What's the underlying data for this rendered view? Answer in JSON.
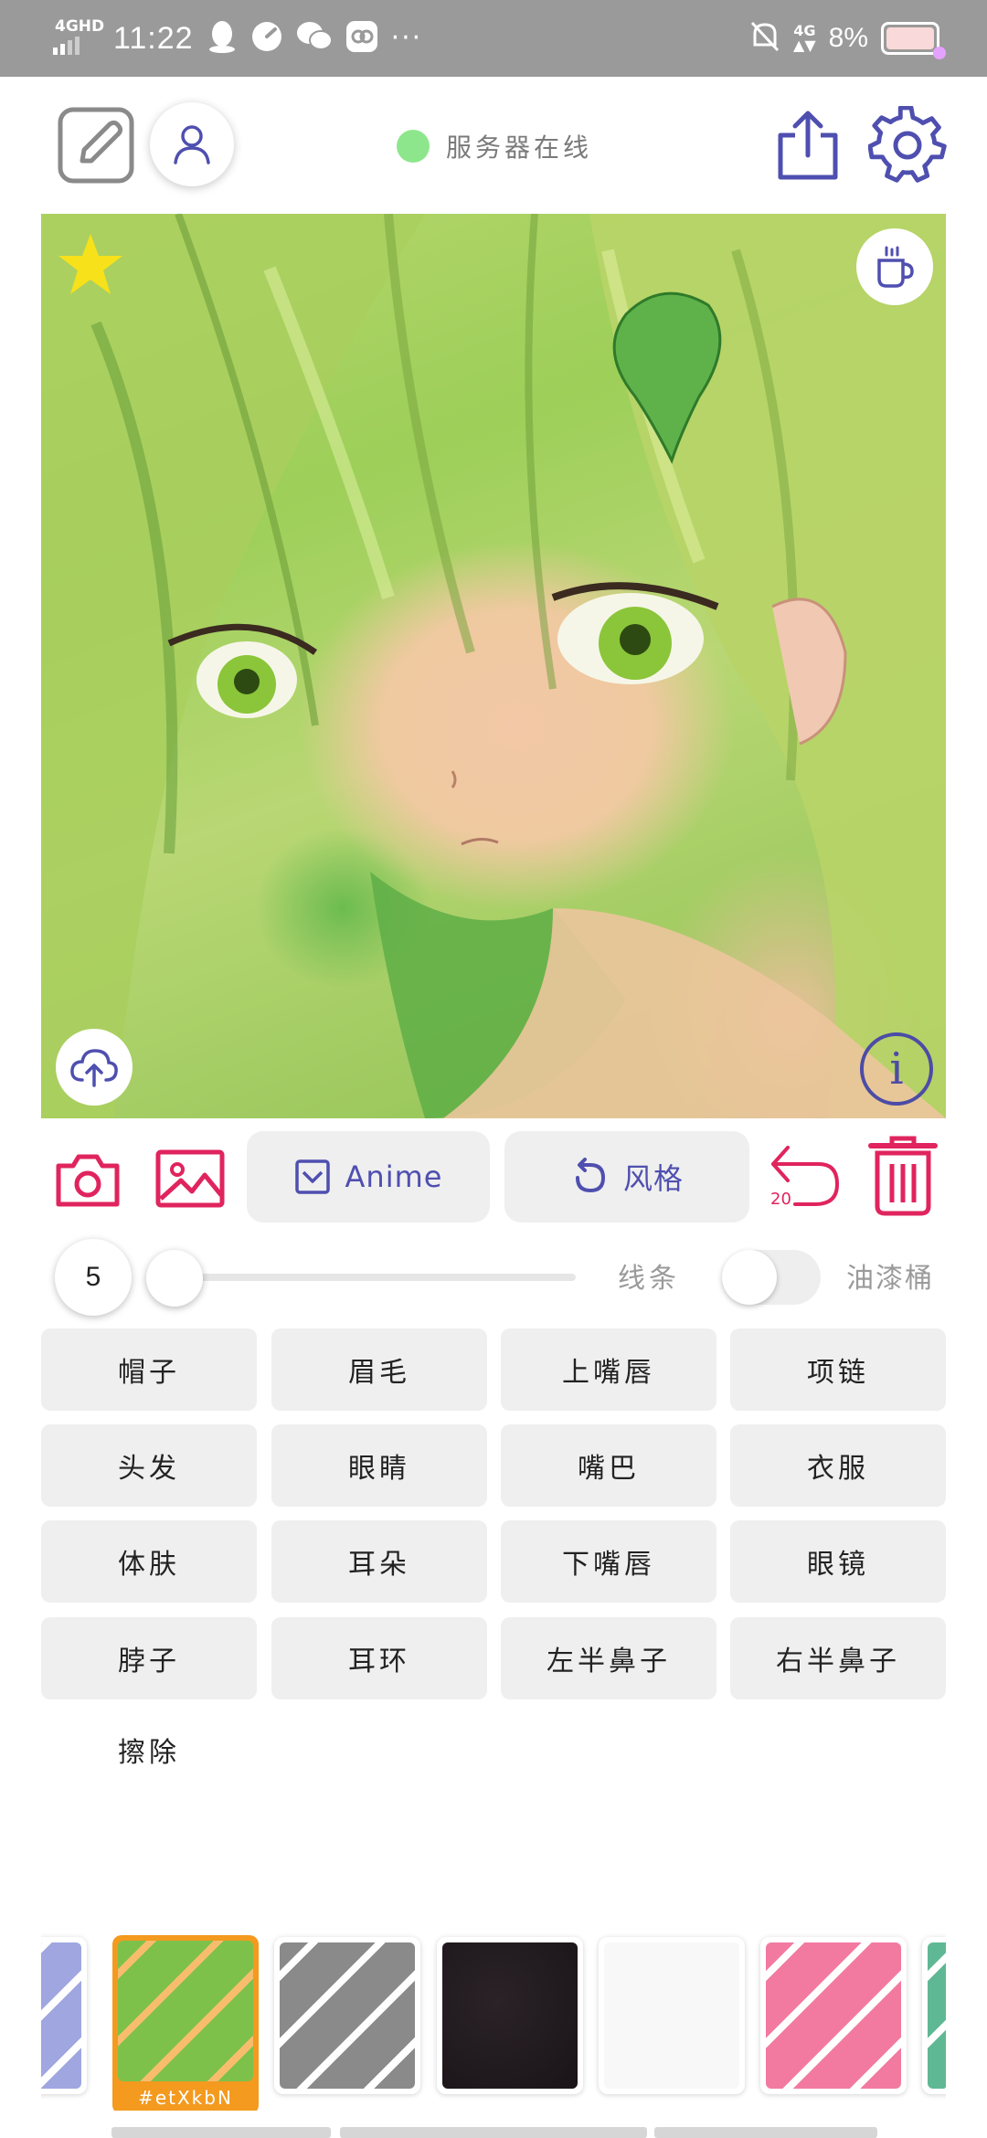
{
  "status_bar": {
    "network": "4GHD",
    "time": "11:22",
    "more": "···",
    "cell": "4G",
    "battery": "8%"
  },
  "toolbar": {
    "server_status": "服务器在线",
    "server_status_color": "#8ee68c",
    "accent_color": "#4f4fb0"
  },
  "canvas": {
    "favorite_color": "#f7e11a",
    "info_glyph": "i"
  },
  "actions": {
    "model_label": "Anime",
    "style_label": "风格",
    "undo_count": "20",
    "danger_color": "#e0245e"
  },
  "brush": {
    "size": "5",
    "slider_value": 0,
    "line_label": "线条",
    "bucket_label": "油漆桶",
    "bucket_enabled": false
  },
  "parts": [
    [
      "帽子",
      "眉毛",
      "上嘴唇",
      "项链"
    ],
    [
      "头发",
      "眼睛",
      "嘴巴",
      "衣服"
    ],
    [
      "体肤",
      "耳朵",
      "下嘴唇",
      "眼镜"
    ],
    [
      "脖子",
      "耳环",
      "左半鼻子",
      "右半鼻子"
    ]
  ],
  "erase_label": "擦除",
  "styles": [
    {
      "name": "purple-swirl",
      "color": "#9fa6e0"
    },
    {
      "name": "green-leaves",
      "color": "#7ec14a",
      "selected": true,
      "caption": "#etXkbN"
    },
    {
      "name": "grey-zebra",
      "color": "#8a8a8a"
    },
    {
      "name": "dark-ink",
      "color": "#1a1418"
    },
    {
      "name": "white-blank",
      "color": "#f8f8f8"
    },
    {
      "name": "pink-brush",
      "color": "#f27aa0"
    },
    {
      "name": "teal-edge",
      "color": "#5fb894"
    }
  ]
}
